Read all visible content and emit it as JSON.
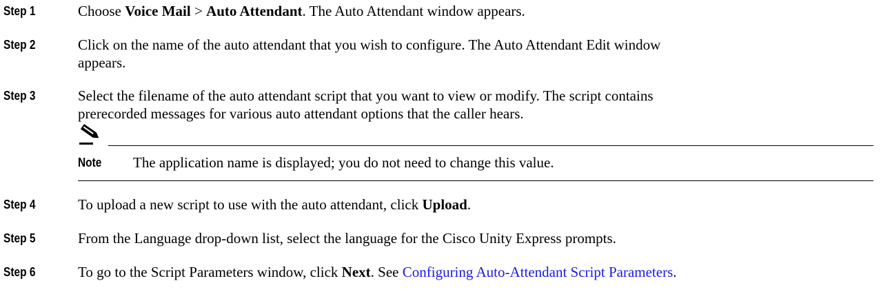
{
  "steps": [
    {
      "label": "Step 1",
      "lines": [
        [
          {
            "t": "Choose "
          },
          {
            "t": "Voice Mail",
            "b": true
          },
          {
            "t": " > "
          },
          {
            "t": "Auto Attendant",
            "b": true
          },
          {
            "t": ". The Auto Attendant window appears."
          }
        ]
      ]
    },
    {
      "label": "Step 2",
      "lines": [
        [
          {
            "t": "Click on the name of the auto attendant that you wish to configure. The Auto Attendant Edit window"
          }
        ],
        [
          {
            "t": "appears."
          }
        ]
      ]
    },
    {
      "label": "Step 3",
      "lines": [
        [
          {
            "t": "Select the filename of the auto attendant script that you want to view or modify. The script contains"
          }
        ],
        [
          {
            "t": "prerecorded messages for various auto attendant options that the caller hears."
          }
        ]
      ]
    },
    {
      "label": "Step 4",
      "lines": [
        [
          {
            "t": "To upload a new script to use with the auto attendant, click "
          },
          {
            "t": "Upload",
            "b": true
          },
          {
            "t": "."
          }
        ]
      ]
    },
    {
      "label": "Step 5",
      "lines": [
        [
          {
            "t": "From the Language drop-down list, select the language for the Cisco Unity Express prompts."
          }
        ]
      ]
    },
    {
      "label": "Step 6",
      "lines": [
        [
          {
            "t": "To go to the Script Parameters window, click "
          },
          {
            "t": "Next",
            "b": true
          },
          {
            "t": ". See "
          },
          {
            "t": "Configuring Auto-Attendant Script Parameters",
            "link": true
          },
          {
            "t": "."
          }
        ]
      ]
    }
  ],
  "note": {
    "label": "Note",
    "text": "The application name is displayed; you do not need to change this value.",
    "icon": "pencil-note-icon"
  },
  "colors": {
    "text": "#000000",
    "link": "#1a1ae6"
  }
}
